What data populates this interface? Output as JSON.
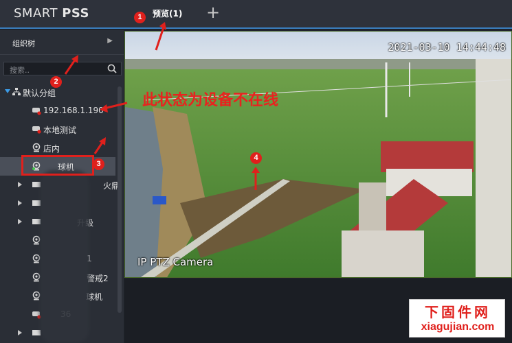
{
  "app": {
    "brand_light": "SMART ",
    "brand_bold": "PSS"
  },
  "tabs": [
    {
      "label": "预览(1)"
    }
  ],
  "tab_add": "+",
  "sidebar": {
    "header": "组织树",
    "search_placeholder": "搜索.."
  },
  "tree": {
    "root": "默认分组",
    "items": [
      {
        "label": "192.168.1.190",
        "icon": "camera-offline-icon"
      },
      {
        "label": "本地测试",
        "icon": "camera-offline-icon"
      },
      {
        "label": "店内",
        "icon": "camera-icon"
      },
      {
        "label": "球机",
        "icon": "camera-online-icon",
        "selected": true
      },
      {
        "label": "火鼎",
        "icon": "device-group-icon"
      },
      {
        "label": "",
        "icon": "device-group-icon"
      },
      {
        "label": "升级",
        "icon": "device-group-icon"
      },
      {
        "label": "",
        "icon": "camera-icon"
      },
      {
        "label": "1",
        "icon": "camera-icon"
      },
      {
        "label": "警戒2",
        "icon": "camera-icon"
      },
      {
        "label": "球机",
        "icon": "camera-icon"
      },
      {
        "label": "36",
        "icon": "camera-offline-icon"
      },
      {
        "label": "",
        "icon": "device-group-icon"
      }
    ]
  },
  "video": {
    "timestamp": "2021-03-10 14:44:48",
    "camera_name": "IP PTZ Camera"
  },
  "annotation": {
    "note": "此状态为设备不在线",
    "badges": [
      "1",
      "2",
      "3",
      "4"
    ],
    "color": "#e0201c"
  },
  "watermark": {
    "line1": "下固件网",
    "line2": "xiagujian.com"
  },
  "colors": {
    "accent": "#3a7fc0",
    "sidebar_bg": "#2a2e36",
    "selected_bg": "#4a4f59"
  }
}
